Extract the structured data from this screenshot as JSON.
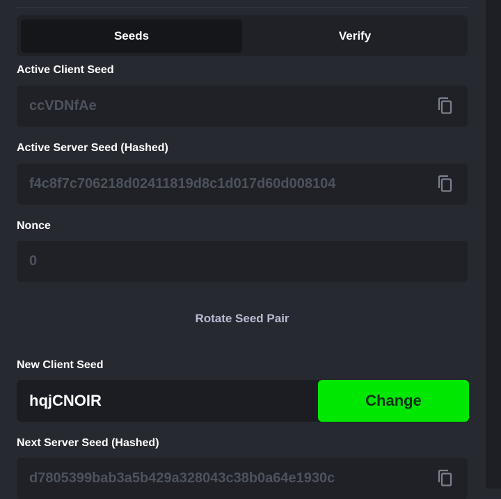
{
  "tabs": {
    "seeds_label": "Seeds",
    "verify_label": "Verify"
  },
  "active_client_seed": {
    "label": "Active Client Seed",
    "value": "ccVDNfAe"
  },
  "active_server_seed": {
    "label": "Active Server Seed (Hashed)",
    "value": "f4c8f7c706218d02411819d8c1d017d60d008104"
  },
  "nonce": {
    "label": "Nonce",
    "value": "0"
  },
  "rotate_label": "Rotate Seed Pair",
  "new_client_seed": {
    "label": "New Client Seed",
    "value": "hqjCNOIR",
    "button_label": "Change"
  },
  "next_server_seed": {
    "label": "Next Server Seed (Hashed)",
    "value": "d7805399bab3a5b429a328043c38b0a64e1930c"
  },
  "colors": {
    "background": "#262930",
    "field": "#1f2127",
    "muted_text": "#4d525c",
    "accent": "#00e701"
  }
}
